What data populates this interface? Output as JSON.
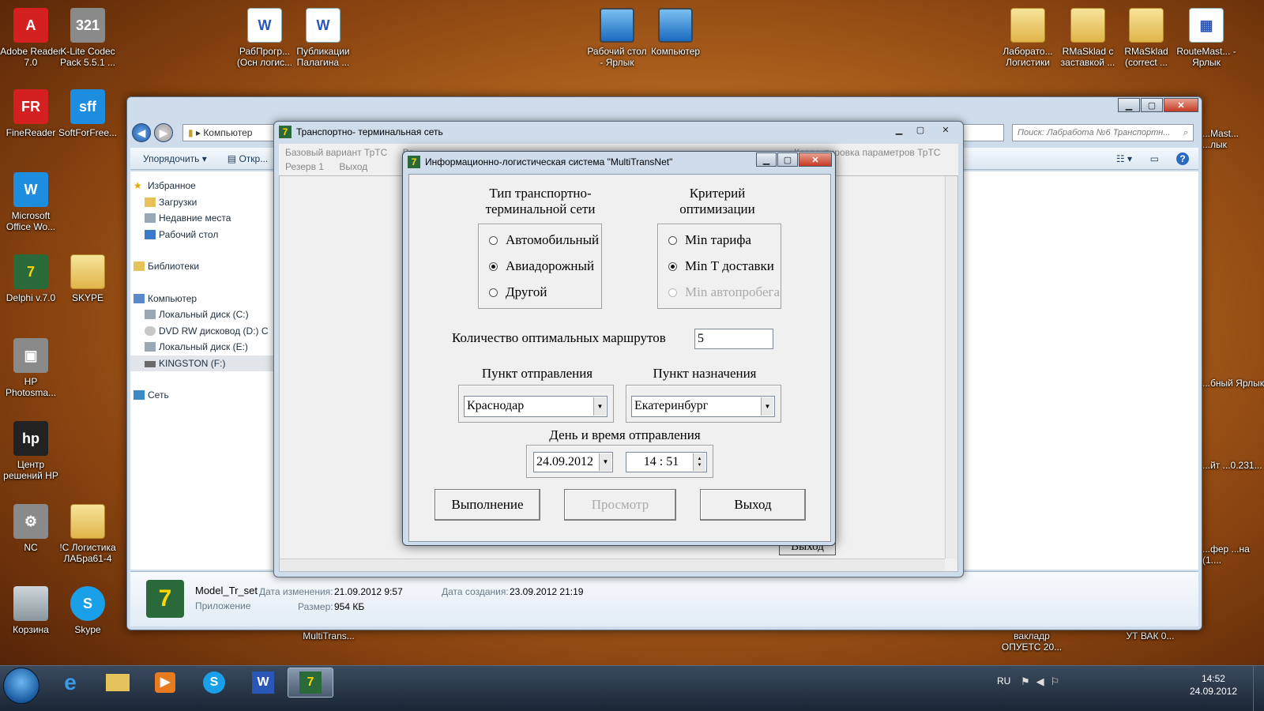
{
  "desktop": {
    "icons": [
      {
        "label": "Adobe Reader 7.0",
        "icon": "pdf-icon"
      },
      {
        "label": "K-Lite Codec Pack 5.5.1 ...",
        "icon": "codec-icon"
      },
      {
        "label": "РабПрогр... (Осн логис...",
        "icon": "word-doc-icon"
      },
      {
        "label": "Публикации Палагина ...",
        "icon": "word-doc-icon"
      },
      {
        "label": "Рабочий стол - Ярлык",
        "icon": "desktop-shortcut-icon"
      },
      {
        "label": "Компьютер",
        "icon": "computer-icon"
      },
      {
        "label": "Лаборато... Логистики",
        "icon": "folder-icon"
      },
      {
        "label": "RMaSklad с заставкой ...",
        "icon": "folder-icon"
      },
      {
        "label": "RMaSklad (correct ...",
        "icon": "folder-icon"
      },
      {
        "label": "RouteMast... - Ярлык",
        "icon": "calendar-icon"
      },
      {
        "label": "FineReader",
        "icon": "finereader-icon"
      },
      {
        "label": "SoftForFree...",
        "icon": "sff-icon"
      },
      {
        "label": "Microsoft Office Wo...",
        "icon": "word-icon"
      },
      {
        "label": "Delphi v.7.0",
        "icon": "delphi-icon"
      },
      {
        "label": "SKYPE",
        "icon": "folder-icon"
      },
      {
        "label": "HP Photosma...",
        "icon": "camera-icon"
      },
      {
        "label": "Центр решений HP",
        "icon": "hp-icon"
      },
      {
        "label": "NC",
        "icon": "nc-icon"
      },
      {
        "label": "!С Логистика ЛАБра61-4",
        "icon": "folder-icon"
      },
      {
        "label": "Корзина",
        "icon": "recycle-bin-icon"
      },
      {
        "label": "Skype",
        "icon": "skype-icon"
      }
    ],
    "right_partial": [
      "...Mast... ...лык",
      "...бный Ярлык",
      "...йт ...0.231...",
      "...фер ...на (1...."
    ],
    "behind_labels": [
      "MultiTrans...",
      "вакладр ОПУЕТС 20...",
      "УТ ВАК 0..."
    ]
  },
  "explorer": {
    "address": "Компьютер",
    "search_placeholder": "Поиск: Лабработа №6 Транспортн...",
    "toolbar": {
      "organize": "Упорядочить",
      "open": "Откр..."
    },
    "sidebar": {
      "favorites": "Избранное",
      "downloads": "Загрузки",
      "recent": "Недавние места",
      "desktop": "Рабочий стол",
      "libraries": "Библиотеки",
      "computer": "Компьютер",
      "disk_c": "Локальный диск (C:)",
      "dvd": "DVD RW дисковод (D:) C",
      "disk_e": "Локальный диск (E:)",
      "kingston": "KINGSTON (F:)",
      "network": "Сеть"
    },
    "details": {
      "name": "Model_Tr_set",
      "type": "Приложение",
      "modified_label": "Дата изменения:",
      "modified_value": "21.09.2012 9:57",
      "size_label": "Размер:",
      "size_value": "954 КБ",
      "created_label": "Дата создания:",
      "created_value": "23.09.2012 21:19"
    }
  },
  "app": {
    "title": "Транспортно- терминальная сеть",
    "menu_row1": [
      "Базовый вариант ТрТС",
      "Ра...",
      "...",
      "...",
      "Корректировка параметров ТрТС"
    ],
    "menu_row2": [
      "Резерв 1",
      "Выход"
    ],
    "hidden_button": "Выход"
  },
  "dialog": {
    "title": "Информационно-логистическая система \"MultiTransNet\"",
    "network_type": {
      "caption_line1": "Тип транспортно-",
      "caption_line2": "терминальной сети",
      "options": [
        "Автомобильный",
        "Авиадорожный",
        "Другой"
      ],
      "selected": 1
    },
    "criterion": {
      "caption_line1": "Критерий",
      "caption_line2": "оптимизации",
      "options": [
        "Min тарифа",
        "Min Т доставки",
        "Min автопробега"
      ],
      "selected": 1,
      "disabled": [
        2
      ]
    },
    "routes_label": "Количество оптимальных маршрутов",
    "routes_value": "5",
    "origin_label": "Пункт отправления",
    "origin_value": "Краснодар",
    "destination_label": "Пункт назначения",
    "destination_value": "Екатеринбург",
    "datetime_label": "День и время отправления",
    "date_value": "24.09.2012",
    "time_value": "14 : 51",
    "buttons": {
      "run": "Выполнение",
      "view": "Просмотр",
      "exit": "Выход"
    }
  },
  "taskbar": {
    "lang": "RU",
    "time": "14:52",
    "date": "24.09.2012"
  }
}
